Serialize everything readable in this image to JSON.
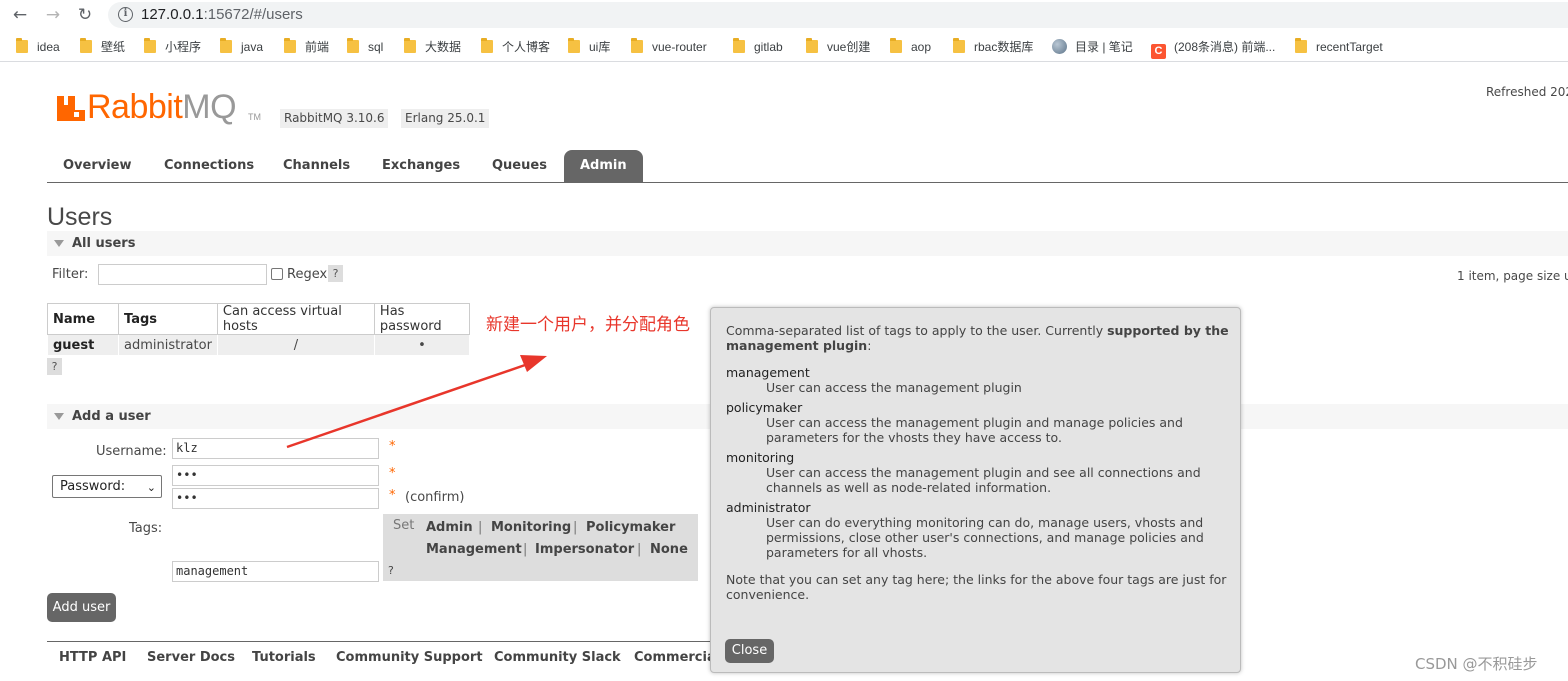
{
  "browser": {
    "url_prefix": "127.0.0.1",
    "url_rest": ":15672/#/users",
    "bookmarks": [
      "idea",
      "壁纸",
      "小程序",
      "java",
      "前端",
      "sql",
      "大数据",
      "个人博客",
      "ui库",
      "vue-router",
      "gitlab",
      "vue创建",
      "aop",
      "rbac数据库",
      "目录 | 笔记",
      "(208条消息) 前端...",
      "recentTarget"
    ]
  },
  "header": {
    "logo_rabbit": "Rabbit",
    "logo_mq": "MQ",
    "logo_tm": "TM",
    "rabbitmq_version": "RabbitMQ 3.10.6",
    "erlang_version": "Erlang 25.0.1",
    "refreshed": "Refreshed 202"
  },
  "tabs": [
    "Overview",
    "Connections",
    "Channels",
    "Exchanges",
    "Queues",
    "Admin"
  ],
  "page_title": "Users",
  "all_users": {
    "heading": "All users",
    "filter_label": "Filter:",
    "regex_label": "Regex",
    "help": "?",
    "page_info": "1 item, page size u",
    "columns": [
      "Name",
      "Tags",
      "Can access virtual hosts",
      "Has password"
    ],
    "rows": [
      {
        "name": "guest",
        "tags": "administrator",
        "vhosts": "/",
        "has_password": "•"
      }
    ]
  },
  "add_user": {
    "heading": "Add a user",
    "username_label": "Username:",
    "username_value": "klz",
    "password_select": "Password:",
    "password_value": "•••",
    "password_confirm_value": "•••",
    "required": "*",
    "confirm_label": "(confirm)",
    "tags_label": "Tags:",
    "set_label": "Set",
    "tag_options": [
      "Admin",
      "Monitoring",
      "Policymaker",
      "Management",
      "Impersonator",
      "None"
    ],
    "tags_value": "management",
    "separator": "|",
    "submit": "Add user"
  },
  "footer_links": [
    "HTTP API",
    "Server Docs",
    "Tutorials",
    "Community Support",
    "Community Slack",
    "Commercia"
  ],
  "annotation": "新建一个用户，并分配角色",
  "popup": {
    "intro_1": "Comma-separated list of tags to apply to the user. Currently ",
    "intro_bold_1": "supported by the",
    "intro_bold_2": "management plugin",
    "intro_2": ":",
    "items": [
      {
        "term": "management",
        "desc": [
          "User can access the management plugin"
        ]
      },
      {
        "term": "policymaker",
        "desc": [
          "User can access the management plugin and manage policies and",
          "parameters for the vhosts they have access to."
        ]
      },
      {
        "term": "monitoring",
        "desc": [
          "User can access the management plugin and see all connections and",
          "channels as well as node-related information."
        ]
      },
      {
        "term": "administrator",
        "desc": [
          "User can do everything monitoring can do, manage users, vhosts and",
          "permissions, close other user's connections, and manage policies and",
          "parameters for all vhosts."
        ]
      }
    ],
    "note_1": "Note that you can set any tag here; the links for the above four tags are just for",
    "note_2": "convenience.",
    "close": "Close"
  },
  "watermark": "CSDN @不积硅步",
  "colors": {
    "brand": "#ff6600",
    "tab_active": "#666666",
    "annotation": "#e8362b"
  }
}
